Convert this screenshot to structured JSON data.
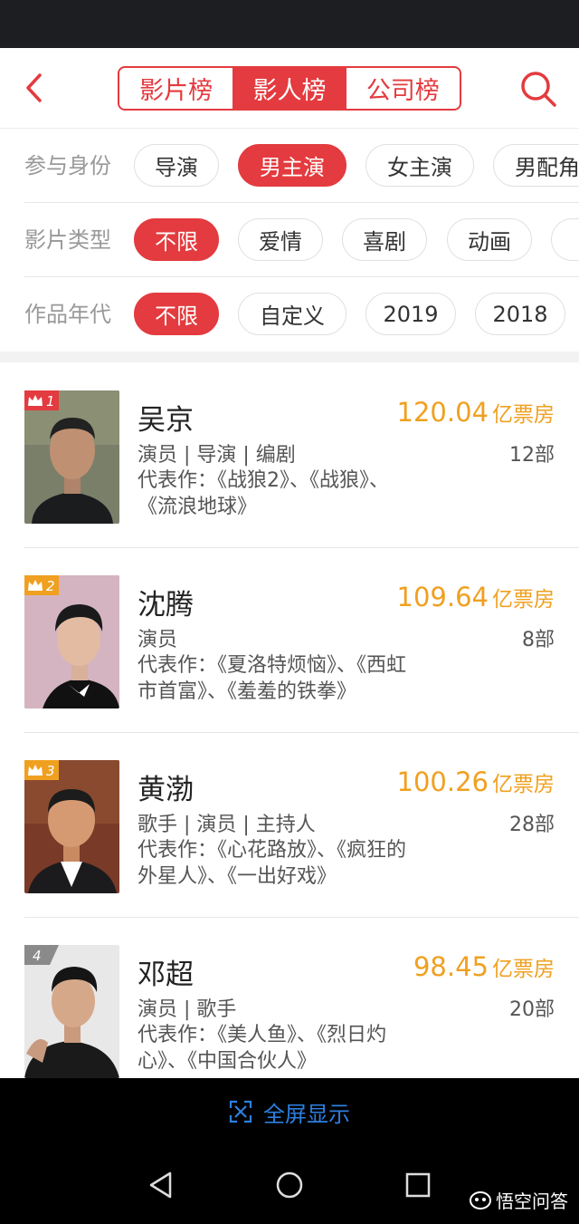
{
  "nav": {
    "tabs": [
      "影片榜",
      "影人榜",
      "公司榜"
    ],
    "active_tab": 1
  },
  "filters": [
    {
      "label": "参与身份",
      "chips": [
        "导演",
        "男主演",
        "女主演",
        "男配角"
      ]
    },
    {
      "label": "影片类型",
      "chips": [
        "不限",
        "爱情",
        "喜剧",
        "动画",
        "剧"
      ]
    },
    {
      "label": "作品年代",
      "chips": [
        "不限",
        "自定义",
        "2019",
        "2018"
      ]
    }
  ],
  "people": [
    {
      "rank": "1",
      "name": "吴京",
      "roles": "演员 | 导演 | 编剧",
      "box_office": "120.04",
      "unit": "亿票房",
      "count": "12部",
      "works_line1": "代表作：《战狼2》、《战狼》、",
      "works_line2": "《流浪地球》"
    },
    {
      "rank": "2",
      "name": "沈腾",
      "roles": "演员",
      "box_office": "109.64",
      "unit": "亿票房",
      "count": "8部",
      "works_line1": "代表作：《夏洛特烦恼》、《西虹",
      "works_line2": "市首富》、《羞羞的铁拳》"
    },
    {
      "rank": "3",
      "name": "黄渤",
      "roles": "歌手 | 演员 | 主持人",
      "box_office": "100.26",
      "unit": "亿票房",
      "count": "28部",
      "works_line1": "代表作：《心花路放》、《疯狂的",
      "works_line2": "外星人》、《一出好戏》"
    },
    {
      "rank": "4",
      "name": "邓超",
      "roles": "演员 | 歌手",
      "box_office": "98.45",
      "unit": "亿票房",
      "count": "20部",
      "works_line1": "代表作：《美人鱼》、《烈日灼",
      "works_line2": "心》、《中国合伙人》"
    }
  ],
  "fullscreen_label": "全屏显示",
  "watermark": "悟空问答",
  "colors": {
    "accent": "#e33b3f",
    "gold": "#f0a020",
    "link": "#2d7fe0"
  }
}
